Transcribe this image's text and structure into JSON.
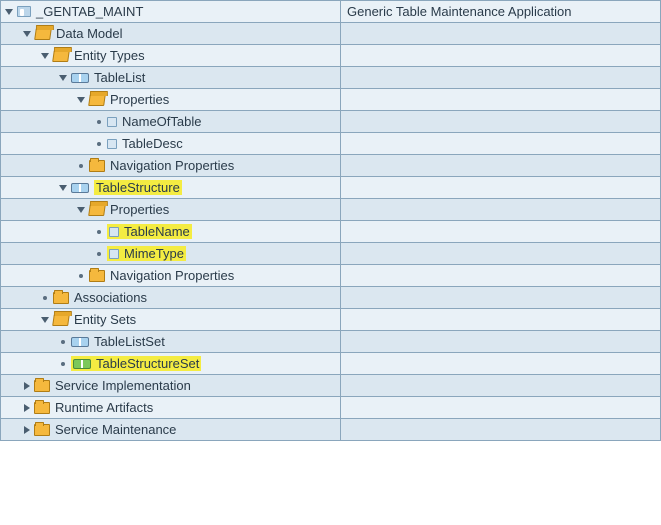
{
  "root": {
    "label": "_GENTAB_MAINT",
    "desc": "Generic Table Maintenance Application"
  },
  "dm": {
    "label": "Data Model",
    "entityTypes": "Entity Types",
    "tableList": {
      "label": "TableList",
      "properties": "Properties",
      "nameOfTable": "NameOfTable",
      "tableDesc": "TableDesc",
      "navProps": "Navigation Properties"
    },
    "tableStructure": {
      "label": "TableStructure",
      "properties": "Properties",
      "tableName": "TableName",
      "mimeType": "MimeType",
      "navProps": "Navigation Properties"
    },
    "associations": "Associations",
    "entitySets": {
      "label": "Entity Sets",
      "tableListSet": "TableListSet",
      "tableStructureSet": "TableStructureSet"
    }
  },
  "svcImpl": "Service Implementation",
  "runtime": "Runtime Artifacts",
  "svcMaint": "Service Maintenance"
}
